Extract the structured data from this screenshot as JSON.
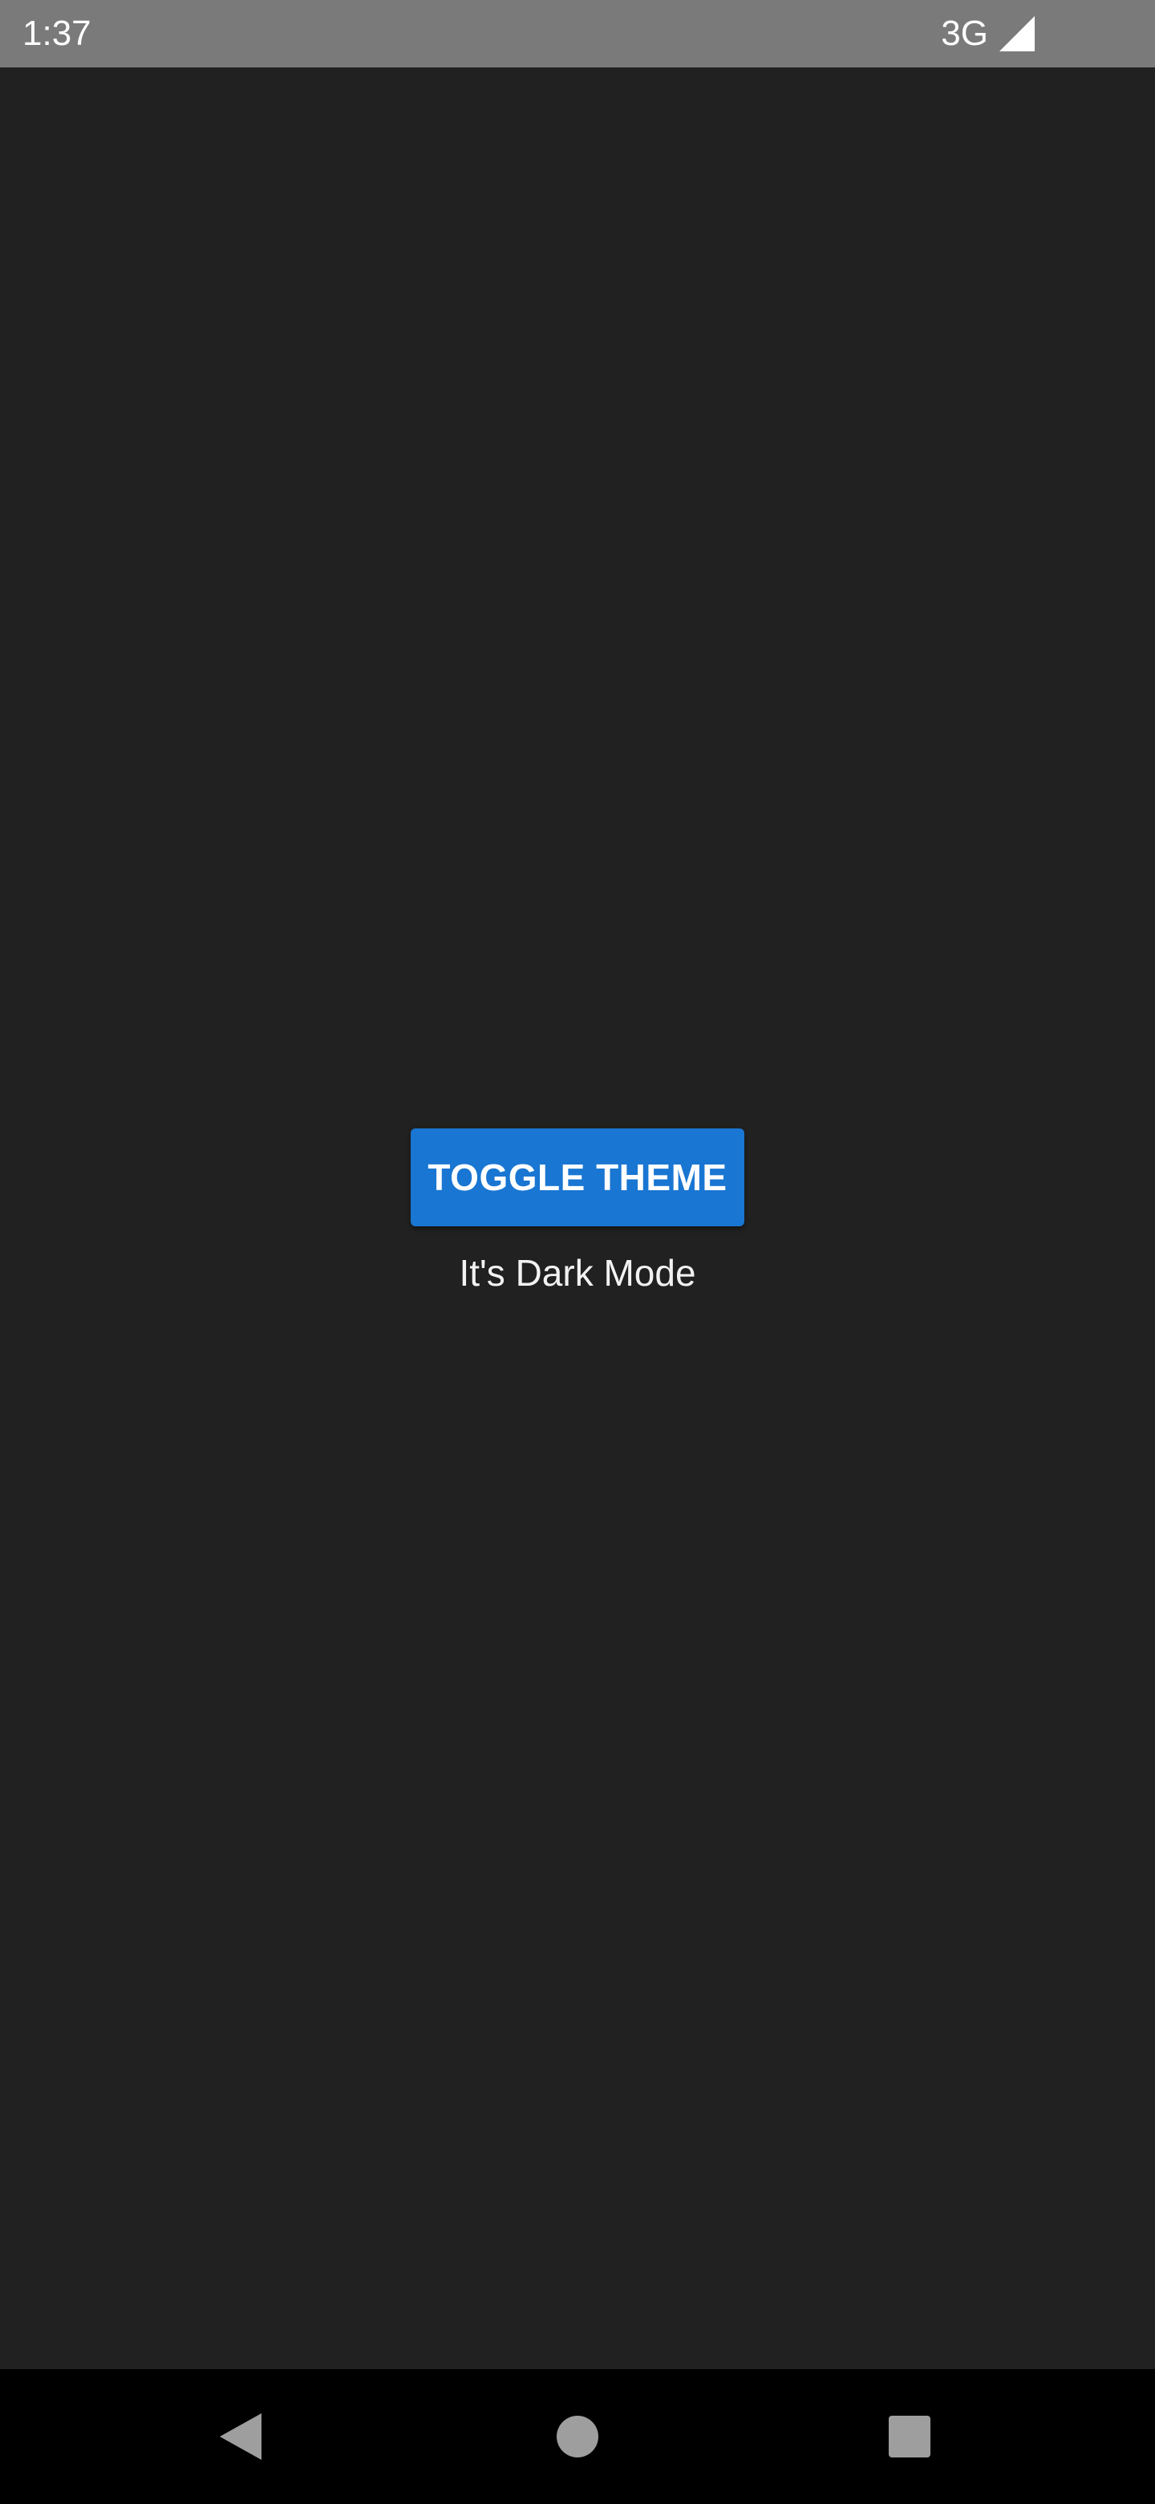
{
  "status_bar": {
    "time": "1:37",
    "network": "3G",
    "signal_icon": "signal-full-icon",
    "background": "#7a7a7a"
  },
  "main": {
    "toggle_button_label": "TOGGLE THEME",
    "mode_text": "It's Dark Mode",
    "background": "#212121",
    "accent": "#1976d2"
  },
  "nav_bar": {
    "back_icon": "back-icon",
    "home_icon": "home-icon",
    "recents_icon": "recents-icon",
    "background": "#000000"
  }
}
